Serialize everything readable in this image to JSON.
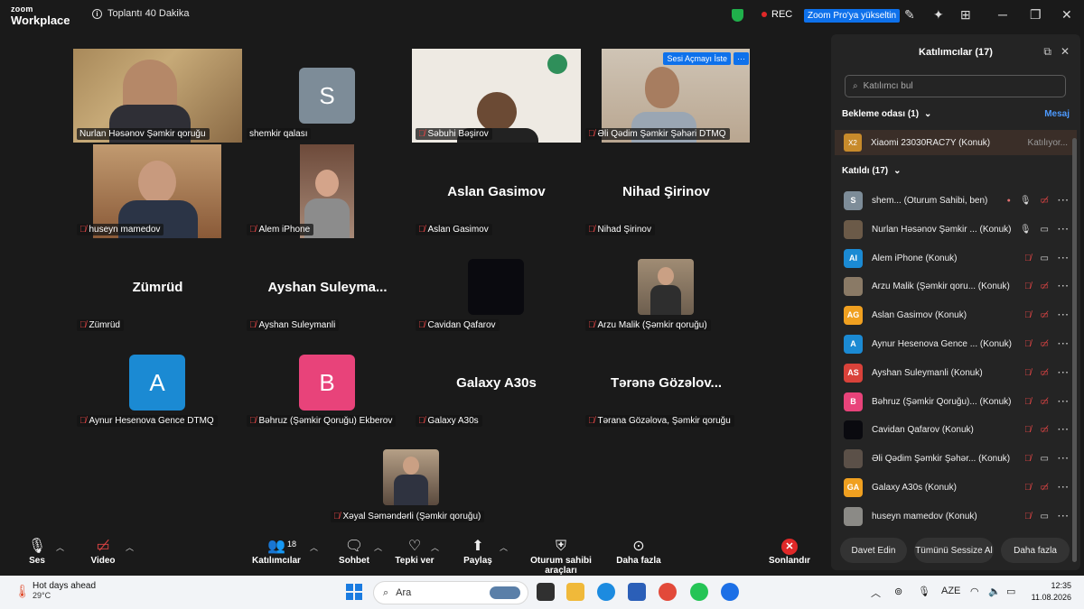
{
  "titlebar": {
    "brand_top": "zoom",
    "brand_bottom": "Workplace",
    "meeting_timer": "Toplantı 40 Dakika",
    "rec_label": "REC",
    "upgrade_label": "Zoom Pro'ya yükseltin"
  },
  "gallery": {
    "tiles": [
      {
        "name": "Nurlan Həsənov Şəmkir qoruğu",
        "type": "video"
      },
      {
        "name": "shemkir qalası",
        "type": "avatar",
        "initial": "S",
        "color": "#7d8c98"
      },
      {
        "name": "Səbuhi Bəşirov",
        "type": "video"
      },
      {
        "name": "Əli Qədim Şəmkir Şəhəri DTMQ",
        "type": "video",
        "badge": "Sesi Açmayı İste",
        "badge_more": "···"
      },
      {
        "name": "huseyn mamedov",
        "type": "video"
      },
      {
        "name": "Alem iPhone",
        "type": "video"
      },
      {
        "name": "Aslan Gasimov",
        "type": "text",
        "big": "Aslan Gasimov"
      },
      {
        "name": "Nihad Şirinov",
        "type": "text",
        "big": "Nihad Şirinov"
      },
      {
        "name": "Zümrüd",
        "type": "text",
        "big": "Zümrüd"
      },
      {
        "name": "Ayshan Suleymanli",
        "type": "text",
        "big": "Ayshan  Suleyma..."
      },
      {
        "name": "Cavidan Qafarov",
        "type": "avatar",
        "initial": "",
        "color": "#0a0a0f"
      },
      {
        "name": "Arzu Malik (Şəmkir qoruğu)",
        "type": "photo"
      },
      {
        "name": "Aynur Hesenova Gence DTMQ",
        "type": "avatar",
        "initial": "A",
        "color": "#1b8ad3"
      },
      {
        "name": "Bəhruz (Şəmkir Qoruğu) Ekberov",
        "type": "avatar",
        "initial": "B",
        "color": "#e8437a"
      },
      {
        "name": "Galaxy A30s",
        "type": "text",
        "big": "Galaxy A30s"
      },
      {
        "name": "Tərana Gözəlova, Şəmkir qoruğu",
        "type": "text",
        "big": "Tərənə  Gözəlov..."
      },
      {
        "name": "Xəyal Səməndərli (Şəmkir qoruğu)",
        "type": "photo"
      }
    ]
  },
  "toolbar": {
    "audio": "Ses",
    "video": "Video",
    "participants": "Katılımcılar",
    "participants_count": "18",
    "chat": "Sohbet",
    "react": "Tepki ver",
    "share": "Paylaş",
    "host_tools": "Oturum sahibi araçları",
    "more": "Daha fazla",
    "end": "Sonlandır"
  },
  "panel": {
    "title": "Katılımcılar (17)",
    "search_placeholder": "Katılımcı bul",
    "waiting_header": "Bekleme odası (1)",
    "message_link": "Mesaj",
    "waiting": {
      "initial": "X2",
      "name": "Xiaomi 23030RAC7Y (Konuk)",
      "status": "Katılıyor..."
    },
    "joined_header": "Katıldı (17)",
    "participants": [
      {
        "initial": "S",
        "color": "#7d8c98",
        "name": "shem... (Oturum Sahibi, ben)",
        "mic": "on",
        "cam": "off",
        "rec": true
      },
      {
        "initial": "",
        "color": "#6b5a48",
        "name": "Nurlan Həsənov Şəmkir ... (Konuk)",
        "mic": "on",
        "cam": "on"
      },
      {
        "initial": "AI",
        "color": "#1b8ad3",
        "name": "Alem iPhone (Konuk)",
        "mic": "off",
        "cam": "on"
      },
      {
        "initial": "",
        "color": "#8a7a66",
        "name": "Arzu Malik (Şəmkir qoru... (Konuk)",
        "mic": "off",
        "cam": "off"
      },
      {
        "initial": "AG",
        "color": "#f0a020",
        "name": "Aslan Gasimov (Konuk)",
        "mic": "off",
        "cam": "off"
      },
      {
        "initial": "A",
        "color": "#1b8ad3",
        "name": "Aynur Hesenova Gence ... (Konuk)",
        "mic": "off",
        "cam": "off"
      },
      {
        "initial": "AS",
        "color": "#d9423a",
        "name": "Ayshan Suleymanli (Konuk)",
        "mic": "off",
        "cam": "off"
      },
      {
        "initial": "B",
        "color": "#e8437a",
        "name": "Bəhruz (Şəmkir Qoruğu)... (Konuk)",
        "mic": "off",
        "cam": "off"
      },
      {
        "initial": "",
        "color": "#0a0a0f",
        "name": "Cavidan Qafarov (Konuk)",
        "mic": "off",
        "cam": "off"
      },
      {
        "initial": "",
        "color": "#5b5048",
        "name": "Əli Qədim Şəmkir Şəhər... (Konuk)",
        "mic": "off",
        "cam": "on"
      },
      {
        "initial": "GA",
        "color": "#f0a020",
        "name": "Galaxy A30s (Konuk)",
        "mic": "off",
        "cam": "off"
      },
      {
        "initial": "",
        "color": "#8b8a86",
        "name": "huseyn mamedov (Konuk)",
        "mic": "off",
        "cam": "on"
      }
    ],
    "invite_btn": "Davet Edin",
    "mute_all_btn": "Tümünü Sessize Al",
    "more_btn": "Daha fazla"
  },
  "taskbar": {
    "weather_title": "Hot days ahead",
    "weather_temp": "29°C",
    "search_label": "Ara",
    "lang": "AZE",
    "time": "12:35",
    "date": "11.08.2026"
  }
}
